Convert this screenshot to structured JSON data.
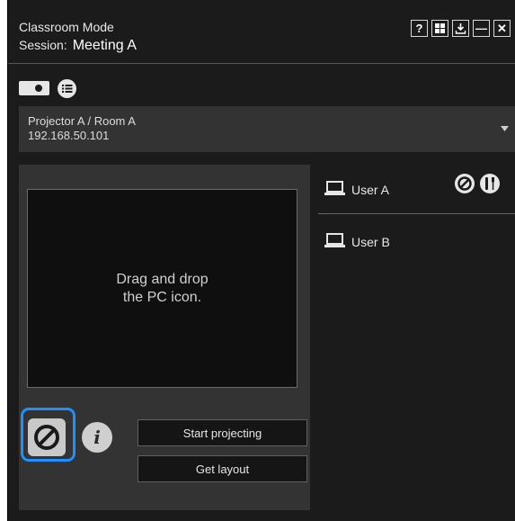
{
  "window": {
    "mode_title": "Classroom Mode",
    "session_label": "Session:",
    "session_name": "Meeting A",
    "buttons": {
      "help": "?",
      "minimize": "—",
      "close": "✕"
    }
  },
  "toolbar": {
    "projector_icon": "projector-icon",
    "list_icon": "list-icon"
  },
  "projector_select": {
    "line1": "Projector A / Room A",
    "line2": "192.168.50.101"
  },
  "drop_zone": {
    "line1": "Drag and drop",
    "line2": "the PC icon."
  },
  "actions": {
    "start_projecting": "Start projecting",
    "get_layout": "Get layout",
    "info_glyph": "i"
  },
  "users": [
    {
      "name": "User A"
    },
    {
      "name": "User B"
    }
  ],
  "colors": {
    "background": "#1b1b1b",
    "panel": "#333333",
    "highlight": "#1e90ff"
  }
}
